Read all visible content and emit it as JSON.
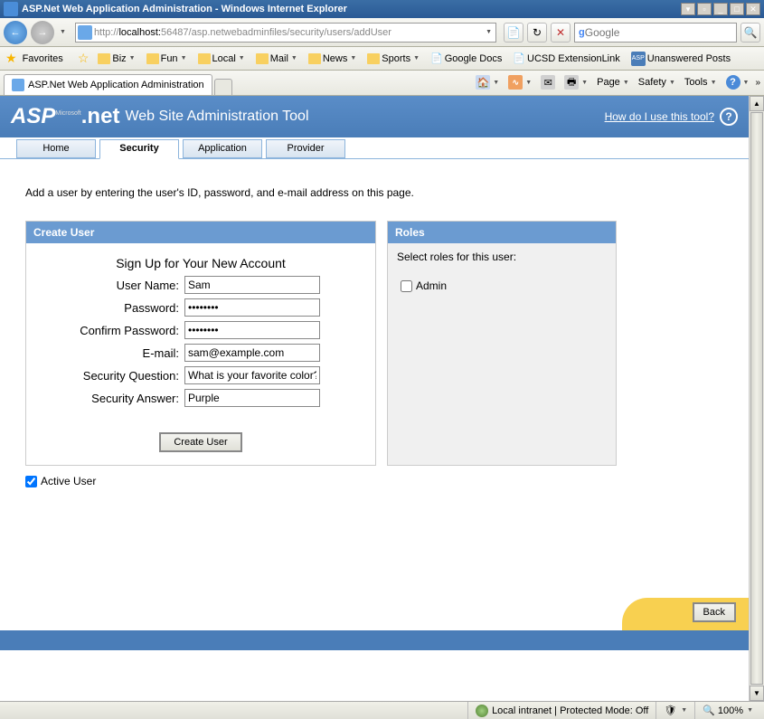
{
  "window": {
    "title": "ASP.Net Web Application Administration - Windows Internet Explorer"
  },
  "address": {
    "url_prefix": "http://",
    "url_host": "localhost:",
    "url_port": "56487",
    "url_path": "/asp.netwebadminfiles/security/users/addUser"
  },
  "search": {
    "placeholder": "Google"
  },
  "favorites": {
    "label": "Favorites",
    "items": [
      {
        "label": "Biz"
      },
      {
        "label": "Fun"
      },
      {
        "label": "Local"
      },
      {
        "label": "Mail"
      },
      {
        "label": "News"
      },
      {
        "label": "Sports"
      }
    ],
    "links": [
      {
        "label": "Google Docs"
      },
      {
        "label": "UCSD ExtensionLink"
      },
      {
        "label": "Unanswered Posts"
      }
    ]
  },
  "browser_tab": {
    "label": "ASP.Net Web Application Administration"
  },
  "ie_menu": {
    "page": "Page",
    "safety": "Safety",
    "tools": "Tools"
  },
  "asp_header": {
    "logo_a": "ASP",
    "logo_b": ".net",
    "logo_sub": "Microsoft",
    "title": "Web Site Administration Tool",
    "help": "How do I use this tool?"
  },
  "tabs": [
    "Home",
    "Security",
    "Application",
    "Provider"
  ],
  "active_tab": "Security",
  "instruction": "Add a user by entering the user's ID, password, and e-mail address on this page.",
  "create_panel": {
    "header": "Create User",
    "title": "Sign Up for Your New Account",
    "fields": {
      "username_label": "User Name:",
      "username_value": "Sam",
      "password_label": "Password:",
      "password_value": "••••••••",
      "confirm_label": "Confirm Password:",
      "confirm_value": "••••••••",
      "email_label": "E-mail:",
      "email_value": "sam@example.com",
      "question_label": "Security Question:",
      "question_value": "What is your favorite color?",
      "answer_label": "Security Answer:",
      "answer_value": "Purple"
    },
    "button": "Create User"
  },
  "roles_panel": {
    "header": "Roles",
    "instruction": "Select roles for this user:",
    "roles": [
      "Admin"
    ]
  },
  "active_user_label": "Active User",
  "back_button": "Back",
  "status": {
    "zone": "Local intranet | Protected Mode: Off",
    "zoom": "100%"
  }
}
